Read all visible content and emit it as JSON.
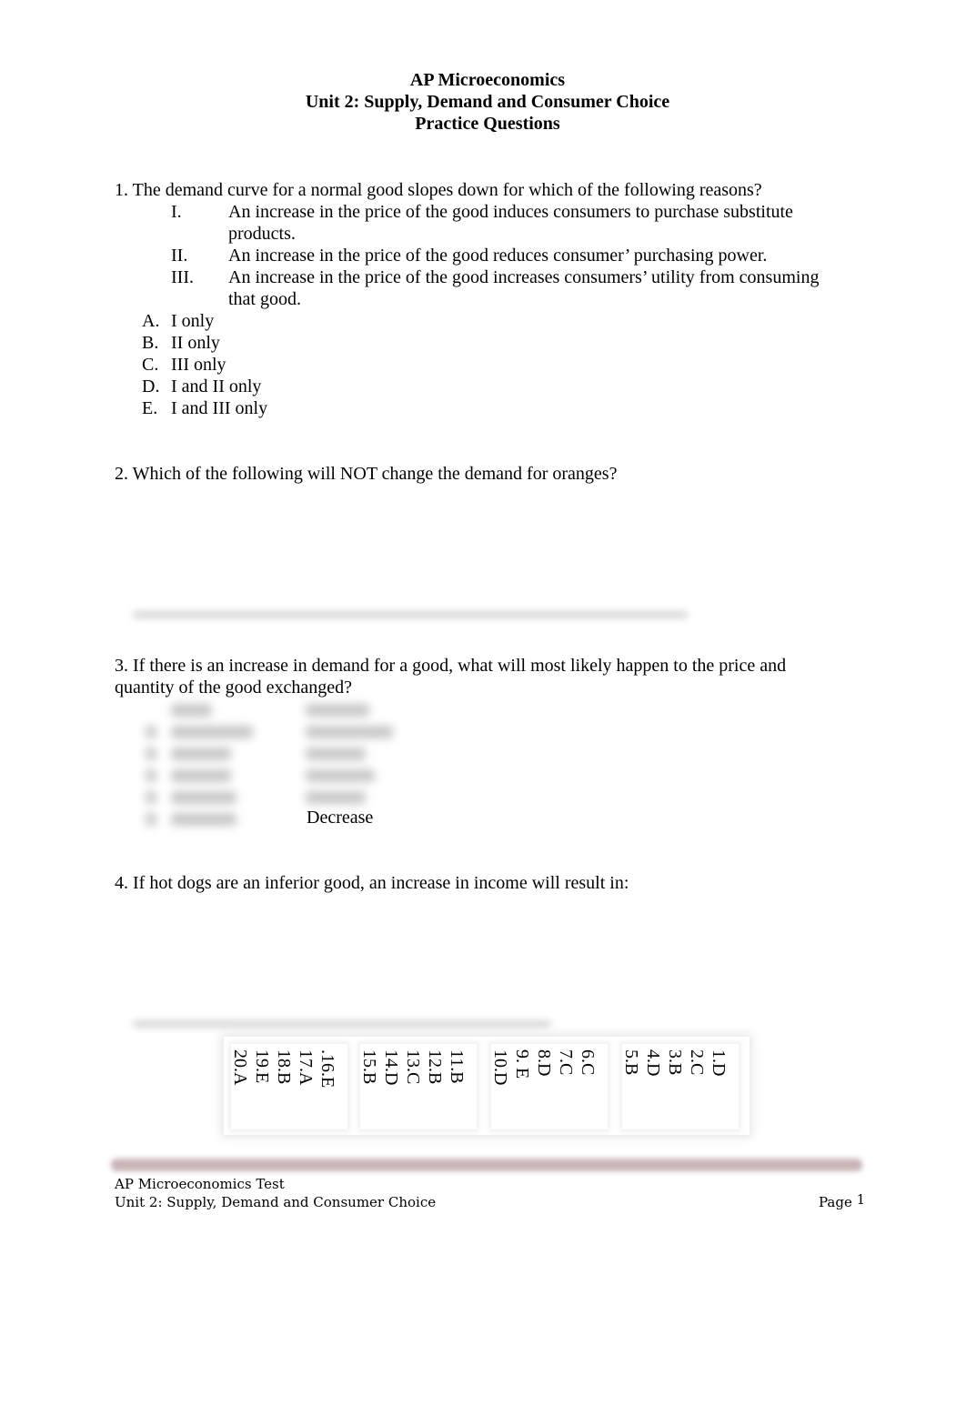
{
  "header": {
    "line1": "AP Microeconomics",
    "line2": "Unit 2:  Supply, Demand and Consumer Choice",
    "line3": "Practice Questions"
  },
  "questions": [
    {
      "number": "1.",
      "text": "1. The demand curve for a normal good slopes down for which of the following reasons?",
      "statements": [
        {
          "numeral": "I.",
          "lines": [
            "An increase in the price of the good induces consumers to purchase substitute",
            "products."
          ]
        },
        {
          "numeral": "II.",
          "lines": [
            "An increase in the price of the good reduces consumer’ purchasing power."
          ]
        },
        {
          "numeral": "III.",
          "lines": [
            "An increase in the price of the good increases consumers’ utility from consuming",
            "that good."
          ]
        }
      ],
      "choices": [
        {
          "letter": "A.",
          "text": "I only"
        },
        {
          "letter": "B.",
          "text": "II only"
        },
        {
          "letter": "C.",
          "text": "III only"
        },
        {
          "letter": "D.",
          "text": "I and II only"
        },
        {
          "letter": "E.",
          "text": "I and III only"
        }
      ]
    },
    {
      "number": "2.",
      "text": "2. Which of the following will NOT change the demand for oranges?"
    },
    {
      "number": "3.",
      "text_lines": [
        "3. If there is an increase in demand for a good, what will most likely happen to the price and",
        "quantity of the good exchanged?"
      ],
      "visible_table_value": "Decrease"
    },
    {
      "number": "4.",
      "text": "4. If hot dogs are an inferior good, an increase in income will result in:"
    }
  ],
  "answer_key": {
    "columns": [
      [
        "1.D",
        "2.C",
        "3.B",
        "4.D",
        "5.B"
      ],
      [
        "6.C",
        "7.C",
        "8.D",
        "9. E",
        "10.D"
      ],
      [
        "11.B",
        "12.B",
        "13.C",
        "14.D",
        "15.B"
      ],
      [
        ".16.E",
        "17.A",
        "18.B",
        "19.E",
        "20.A"
      ]
    ]
  },
  "footer": {
    "line1": "AP Microeconomics Test",
    "line2": "Unit 2:  Supply, Demand and Consumer Choice",
    "page_label": "Page",
    "page_number": "1",
    "rule_color": "#c9b5b7"
  }
}
